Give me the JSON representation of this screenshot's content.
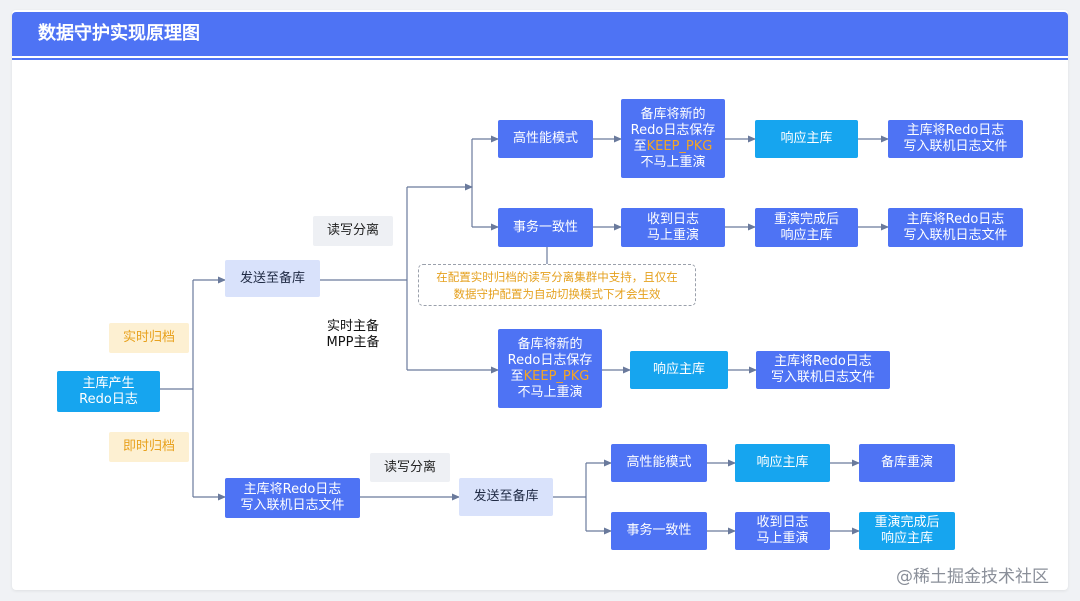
{
  "title": "数据守护实现原理图",
  "watermark": "@稀土掘金技术社区",
  "nodes": {
    "source": [
      "主库产生",
      "Redo日志"
    ],
    "tag_realtime": "实时归档",
    "tag_instant": "即时归档",
    "send_standby_top": "发送至备库",
    "rw_split_top": "读写分离",
    "realtime_primary": [
      "实时主备",
      "MPP主备"
    ],
    "hp_mode_top": "高性能模式",
    "standby_keep_top": [
      "备库将新的",
      "Redo日志保存",
      "至",
      "KEEP_PKG",
      "不马上重演"
    ],
    "respond_top": "响应主库",
    "primary_write_top": [
      "主库将Redo日志",
      "写入联机日志文件"
    ],
    "tx_consistent_top": "事务一致性",
    "received_top": [
      "收到日志",
      "马上重演"
    ],
    "replay_done_top": [
      "重演完成后",
      "响应主库"
    ],
    "primary_write_mid": [
      "主库将Redo日志",
      "写入联机日志文件"
    ],
    "note": [
      "在配置实时归档的读写分离集群中支持，且仅在",
      "数据守护配置为自动切换模式下才会生效"
    ],
    "standby_keep_mid": [
      "备库将新的",
      "Redo日志保存",
      "至",
      "KEEP_PKG",
      "不马上重演"
    ],
    "respond_mid": "响应主库",
    "primary_write_mid2": [
      "主库将Redo日志",
      "写入联机日志文件"
    ],
    "primary_write_bottom": [
      "主库将Redo日志",
      "写入联机日志文件"
    ],
    "rw_split_bottom": "读写分离",
    "send_standby_bottom": "发送至备库",
    "hp_mode_bottom": "高性能模式",
    "respond_bottom": "响应主库",
    "standby_replay": "备库重演",
    "tx_consistent_bottom": "事务一致性",
    "received_bottom": [
      "收到日志",
      "马上重演"
    ],
    "replay_done_bottom": [
      "重演完成后",
      "响应主库"
    ]
  },
  "colors": {
    "header": "#4e73f4",
    "box_blue": "#4e73f4",
    "box_cyan": "#16a5ef",
    "box_lavender": "#d9e2fb",
    "tag_bg": "#fdf0d2",
    "tag_text": "#e8a21f",
    "highlight": "#f5a623",
    "edge": "#6a7a9c"
  }
}
